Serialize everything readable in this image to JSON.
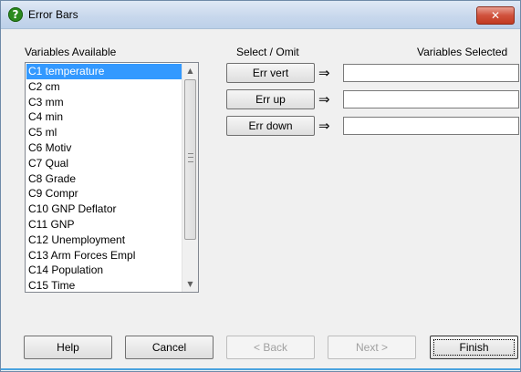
{
  "window": {
    "title": "Error Bars",
    "close_glyph": "✕",
    "app_icon": "help-question-icon",
    "app_icon_glyph": "?"
  },
  "variables_available": {
    "label": "Variables Available",
    "items": [
      "C1 temperature",
      "C2 cm",
      "C3 mm",
      "C4 min",
      "C5 ml",
      "C6 Motiv",
      "C7 Qual",
      "C8 Grade",
      "C9 Compr",
      "C10 GNP Deflator",
      "C11 GNP",
      "C12 Unemployment",
      "C13 Arm Forces Empl",
      "C14 Population",
      "C15 Time"
    ],
    "selected_index": 0
  },
  "select_omit_label": "Select / Omit",
  "variables_selected_label": "Variables Selected",
  "assign": {
    "err_vert": "Err vert",
    "err_up": "Err up",
    "err_down": "Err down",
    "arrow_glyph": "⇒"
  },
  "fields": {
    "err_vert_value": "",
    "err_up_value": "",
    "err_down_value": ""
  },
  "buttons": {
    "help": "Help",
    "cancel": "Cancel",
    "back": "< Back",
    "next": "Next >",
    "finish": "Finish"
  },
  "scrollbar": {
    "up_glyph": "▲",
    "down_glyph": "▼"
  }
}
